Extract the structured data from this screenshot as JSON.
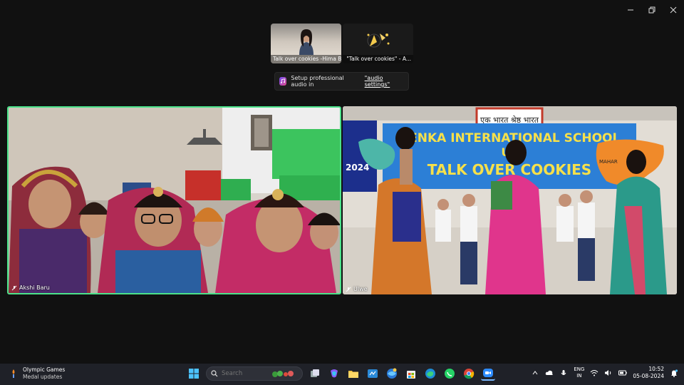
{
  "window": {
    "controls": [
      "minimize",
      "restore",
      "close"
    ]
  },
  "participants_strip": [
    {
      "label": "Talk over cookies -Hima Ba...",
      "muted": false
    },
    {
      "label": "\"Talk over cookies\" - A...",
      "muted": true
    }
  ],
  "toast": {
    "text": "Setup professional audio in",
    "link": "\"audio settings\""
  },
  "tiles": [
    {
      "name": "Akshi Baru",
      "muted": true,
      "active_speaker": true
    },
    {
      "name": "Ulwe",
      "muted": true,
      "active_speaker": false
    }
  ],
  "scene_right": {
    "banner_top": "एक भारत श्रेष्ठ भारत",
    "banner_line1": "OENKA INTERNATIONAL SCHOOL",
    "banner_line2": "UL",
    "banner_line3": "TALK OVER COOKIES",
    "banner_left_year": "2024",
    "banner_right_word": "MAHAR"
  },
  "taskbar": {
    "weather_title": "Olympic Games",
    "weather_sub": "Medal updates",
    "search_placeholder": "Search",
    "pinned": [
      "windows-start",
      "task-view",
      "copilot",
      "file-explorer",
      "app-store-blue",
      "browser-ball",
      "microsoft-store",
      "edge",
      "whatsapp",
      "chrome",
      "zoom"
    ],
    "lang_top": "ENG",
    "lang_bottom": "IN",
    "time": "10:52",
    "date": "05-08-2024"
  },
  "colors": {
    "active_speaker_border": "#4be28a",
    "taskbar_bg": "#1f2128",
    "stage_bg": "#111111"
  }
}
